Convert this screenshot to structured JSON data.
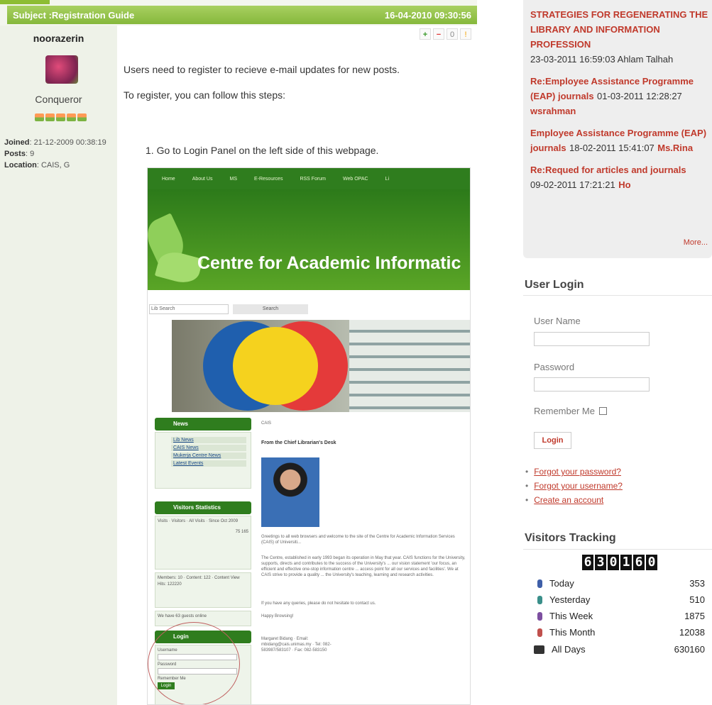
{
  "post": {
    "subject": "Subject :Registration Guide",
    "date": "16-04-2010 09:30:56",
    "author": "noorazerin",
    "rank": "Conqueror",
    "joined_label": "Joined",
    "joined_value": ": 21-12-2009 00:38:19",
    "posts_label": "Posts",
    "posts_value": ": 9",
    "location_label": "Location",
    "location_value": ": CAIS, G",
    "vote_count": "0",
    "paragraph1": "Users need to register to recieve e-mail updates for new posts.",
    "paragraph2": "To register, you can follow this steps:",
    "step1": "1. Go to Login Panel on the left side of this webpage."
  },
  "screenshot": {
    "nav": [
      "Home",
      "About Us",
      "MS",
      "E-Resources",
      "RSS Forum",
      "Web OPAC",
      "Li"
    ],
    "banner_title": "Centre for Academic Informatic",
    "search_placeholder": "Lib Search",
    "search_button": "Search",
    "cais_label": "CAIS",
    "news_head": "News",
    "news_links": [
      "Lib News",
      "CAIS News",
      "Mukerja Centre News",
      "Latest Events"
    ],
    "visitors_head": "Visitors Statistics",
    "visitors_text": "Visits · Visitors · All Visits · Since Oct 2009",
    "visitors_total": "75 165",
    "members_text": "Members: 10 · Content: 122 · Content View Hits: 122220",
    "guests_text": "We have 63 guests online",
    "login_head": "Login",
    "username_label": "Username",
    "password_label": "Password",
    "remember_label": "Remember Me",
    "login_button": "Login",
    "desk_title": "From the Chief Librarian's Desk",
    "greeting": "Greetings to all web browsers and welcome to the site of the Centre for Academic Information Services (CAIS) of Universiti...",
    "body_text": "The Centre, established in early 1993 began its operation in May that year. CAIS functions for the University, supports, directs and contributes to the success of the University's ... our vision statement 'our focus, an efficient and effective one-stop information centre ... access point for all our services and facilities'. We at CAIS strive to provide a quality ... the University's teaching, learning and research activities.",
    "queries_text": "If you have any queries, please do not hesitate to contact us.",
    "happy_text": "Happy Browsing!",
    "signature": "Margaret Bidang · Email: mbidang@cais.unimas.my · Tel: 082-583987/583107 · Fax: 082-583150"
  },
  "sidebar": {
    "latest": [
      {
        "title": "STRATEGIES FOR REGENERATING THE LIBRARY AND INFORMATION PROFESSION",
        "meta": "23-03-2011 16:59:03 Ahlam Talhah",
        "user": ""
      },
      {
        "title": "Re:Employee Assistance Programme (EAP) journals",
        "meta": "01-03-2011 12:28:27",
        "user": "wsrahman"
      },
      {
        "title": "Employee Assistance Programme (EAP) journals",
        "meta": "18-02-2011 15:41:07",
        "user": "Ms.Rina"
      },
      {
        "title": "Re:Requed for articles and journals",
        "meta": "09-02-2011 17:21:21",
        "user": "Ho"
      }
    ],
    "more": "More...",
    "login_title": "User Login",
    "username_label": "User Name",
    "password_label": "Password",
    "remember_label": "Remember Me",
    "login_button": "Login",
    "links": [
      "Forgot your password?",
      "Forgot your username?",
      "Create an account"
    ],
    "visitors_title": "Visitors Tracking",
    "counter": [
      "6",
      "3",
      "0",
      "1",
      "6",
      "0"
    ],
    "stats": [
      {
        "label": "Today",
        "value": "353",
        "color": "#3f5fa8"
      },
      {
        "label": "Yesterday",
        "value": "510",
        "color": "#3a8f8a"
      },
      {
        "label": "This Week",
        "value": "1875",
        "color": "#7d4fa0"
      },
      {
        "label": "This Month",
        "value": "12038",
        "color": "#c0504d"
      },
      {
        "label": "All Days",
        "value": "630160",
        "color": "#333333"
      }
    ]
  }
}
